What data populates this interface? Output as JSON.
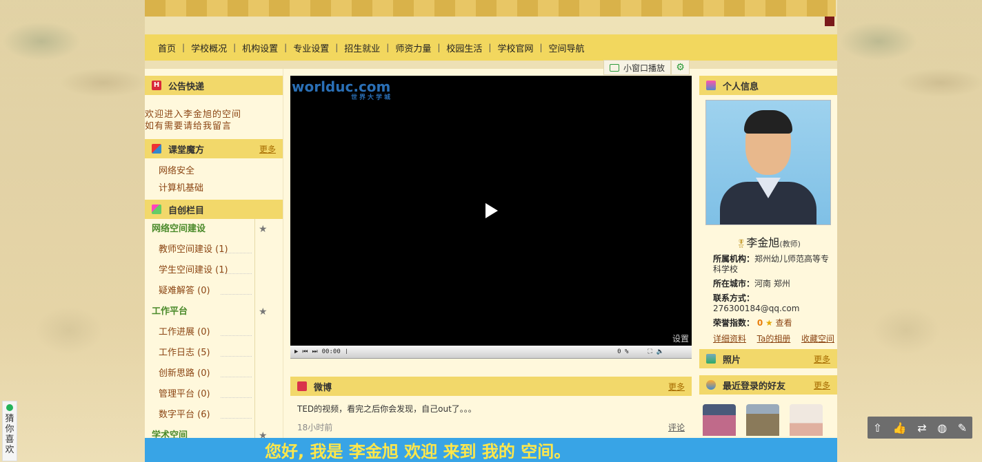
{
  "nav": {
    "items": [
      "首页",
      "学校概况",
      "机构设置",
      "专业设置",
      "招生就业",
      "师资力量",
      "校园生活",
      "学校官网",
      "空间导航"
    ],
    "separator": "|"
  },
  "left": {
    "notice": {
      "title": "公告快递",
      "line1": "欢迎进入李金旭的空间",
      "line2": "如有需要请给我留言"
    },
    "classroom": {
      "title": "课堂魔方",
      "more": "更多",
      "items": [
        "网络安全",
        "计算机基础"
      ]
    },
    "custom": {
      "title": "自创栏目",
      "cat1": "网络空间建设",
      "cat1_items": [
        "教师空间建设 (1)",
        "学生空间建设 (1)",
        "疑难解答 (0)"
      ],
      "cat2": "工作平台",
      "cat2_items": [
        "工作进展 (0)",
        "工作日志 (5)",
        "创新思路 (0)",
        "管理平台 (0)",
        "数字平台 (6)"
      ],
      "cat3": "学术空间"
    }
  },
  "player": {
    "mini_play_label": "小窗口播放",
    "logo_text": "worlduc.com",
    "logo_sub": "世界大学城",
    "settings": "设置",
    "time": "00:00",
    "percent": "0 %"
  },
  "weibo": {
    "title": "微博",
    "more": "更多",
    "post": "TED的视频，看完之后你会发现，自己out了。。。",
    "time": "18小时前",
    "comment": "评论"
  },
  "profile": {
    "title": "个人信息",
    "name": "李金旭",
    "role": "(教师)",
    "org_label": "所属机构：",
    "org_value": "郑州幼儿师范高等专科学校",
    "city_label": "所在城市：",
    "city_value": "河南 郑州",
    "contact_label": "联系方式：",
    "contact_value": "276300184@qq.com",
    "honor_label": "荣誉指数：",
    "honor_value": "0",
    "honor_view": "查看",
    "links": [
      "详细资料",
      "Ta的相册",
      "收藏空间"
    ]
  },
  "photos": {
    "title": "照片",
    "more": "更多"
  },
  "friends": {
    "title": "最近登录的好友",
    "more": "更多",
    "colors": [
      "#c06a8a",
      "#8a7a5a",
      "#f0e8e0"
    ]
  },
  "guess": {
    "text": "猜你喜欢"
  },
  "banner": {
    "text": "您好, 我是 李金旭 欢迎 来到 我的 空间。"
  }
}
